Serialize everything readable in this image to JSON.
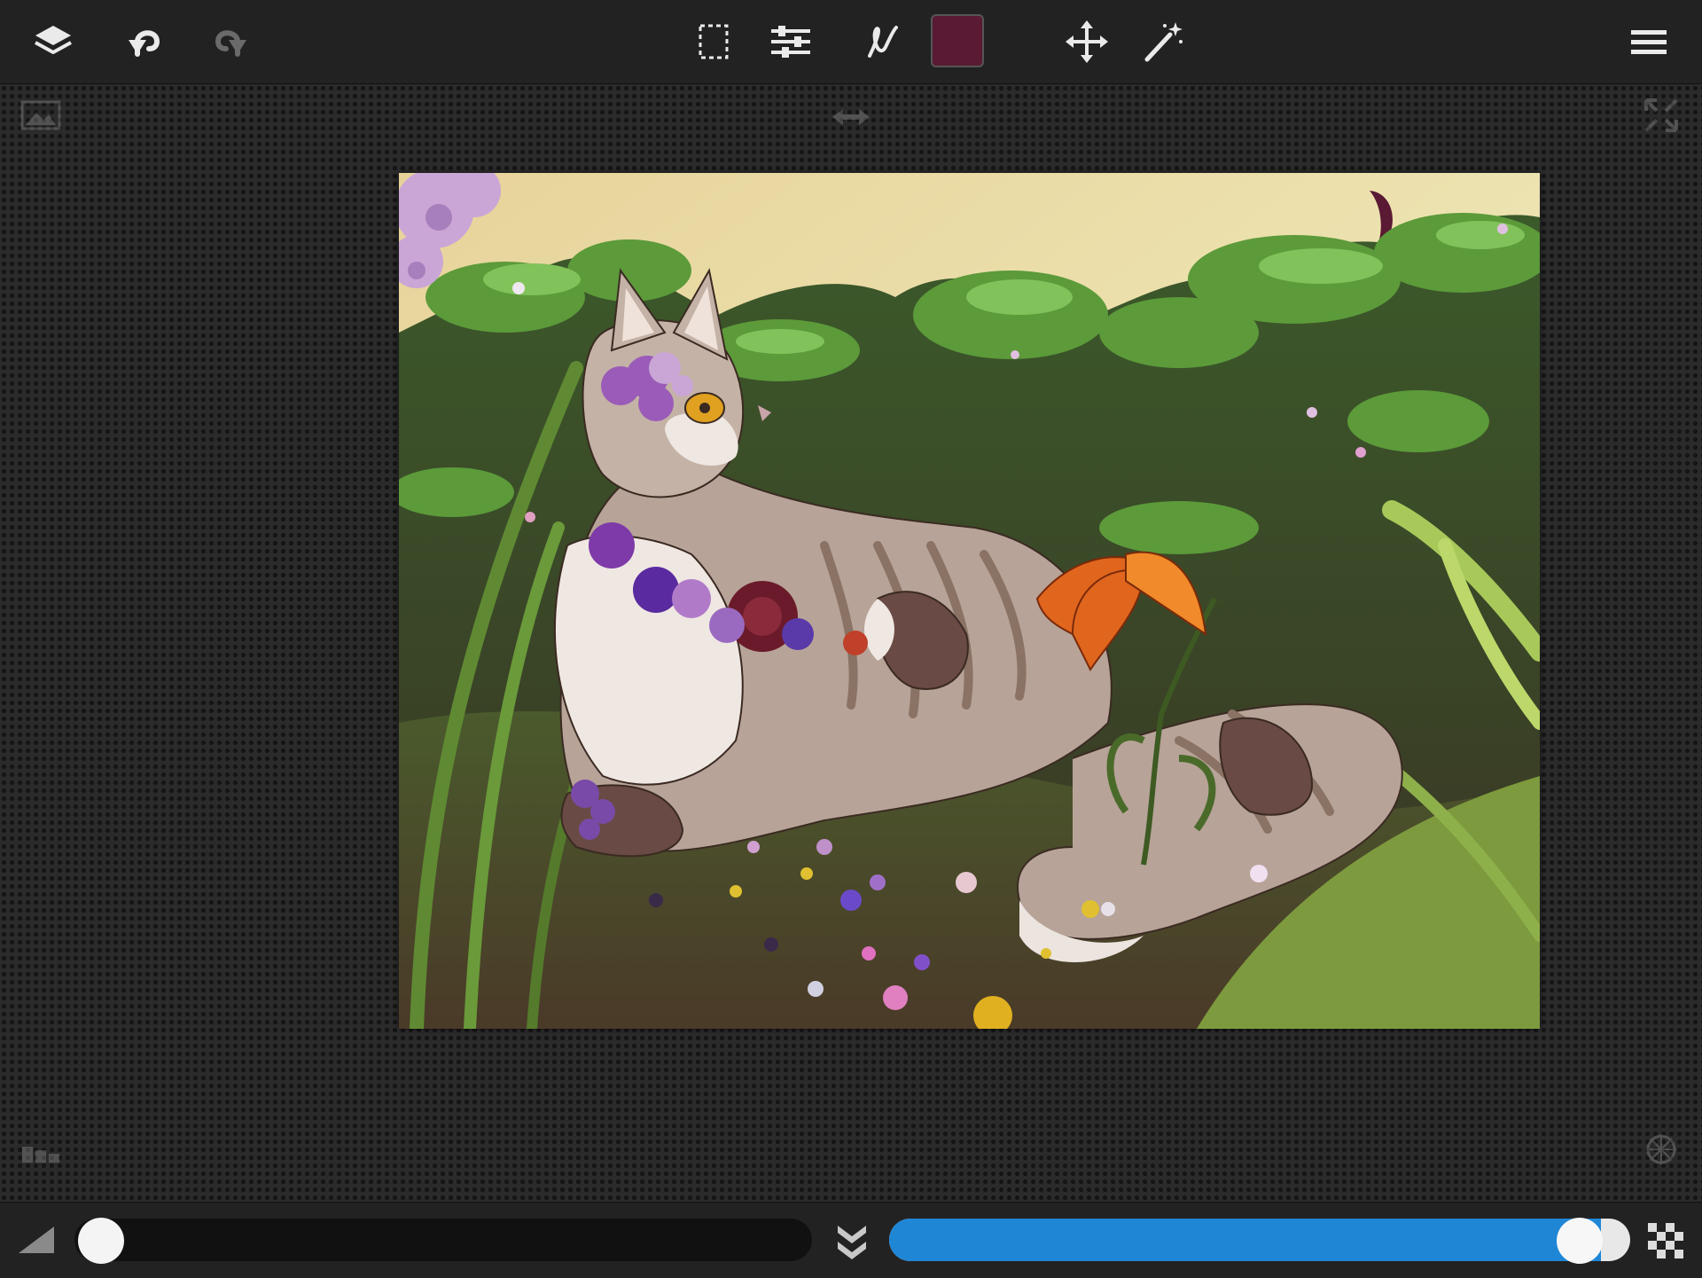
{
  "app": {
    "name": "drawing canvas"
  },
  "toolbar": {
    "left_tools": [
      {
        "icon": "layers-icon"
      },
      {
        "icon": "undo-icon"
      },
      {
        "icon": "redo-icon"
      }
    ],
    "center_tools": [
      {
        "icon": "selection-icon"
      },
      {
        "icon": "adjustments-icon"
      },
      {
        "icon": "brush-icon"
      },
      {
        "icon": "color-swatch"
      },
      {
        "icon": "move-icon"
      },
      {
        "icon": "magic-wand-icon"
      }
    ],
    "right_tools": [
      {
        "icon": "menu-icon"
      }
    ]
  },
  "current_color": "#5a1a33",
  "brush": {
    "size_fraction": 0.01
  },
  "opacity": {
    "fraction": 0.96
  },
  "colors": {
    "toolbar_bg": "#222222",
    "accent": "#1f86d6",
    "canvas_bg": "#2b2b2b"
  }
}
